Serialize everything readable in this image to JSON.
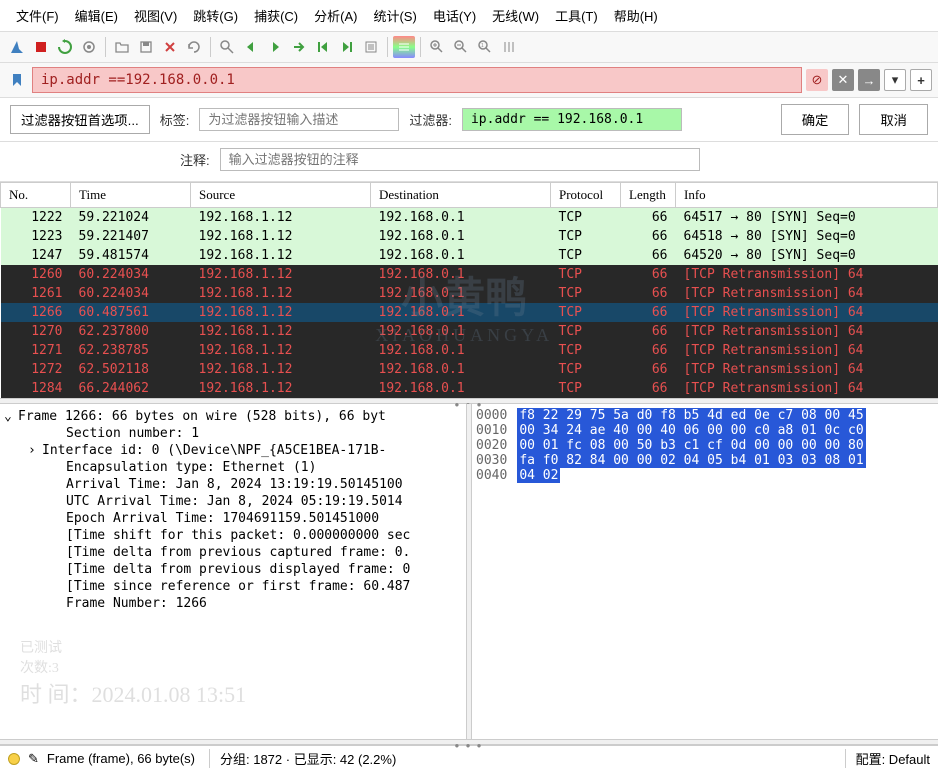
{
  "menu": [
    "文件(F)",
    "编辑(E)",
    "视图(V)",
    "跳转(G)",
    "捕获(C)",
    "分析(A)",
    "统计(S)",
    "电话(Y)",
    "无线(W)",
    "工具(T)",
    "帮助(H)"
  ],
  "filter": {
    "value": "ip.addr ==192.168.0.0.1"
  },
  "pref": {
    "btn": "过滤器按钮首选项...",
    "label_tag": "标签:",
    "tag_placeholder": "为过滤器按钮输入描述",
    "label_filter": "过滤器:",
    "filter_value": "ip.addr == 192.168.0.1",
    "label_comment": "注释:",
    "comment_placeholder": "输入过滤器按钮的注释",
    "ok": "确定",
    "cancel": "取消"
  },
  "cols": {
    "no": "No.",
    "time": "Time",
    "src": "Source",
    "dst": "Destination",
    "proto": "Protocol",
    "len": "Length",
    "info": "Info"
  },
  "packets": [
    {
      "cls": "green",
      "no": "1222",
      "time": "59.221024",
      "src": "192.168.1.12",
      "dst": "192.168.0.1",
      "proto": "TCP",
      "len": "66",
      "info": "64517 → 80 [SYN] Seq=0"
    },
    {
      "cls": "green",
      "no": "1223",
      "time": "59.221407",
      "src": "192.168.1.12",
      "dst": "192.168.0.1",
      "proto": "TCP",
      "len": "66",
      "info": "64518 → 80 [SYN] Seq=0"
    },
    {
      "cls": "green",
      "no": "1247",
      "time": "59.481574",
      "src": "192.168.1.12",
      "dst": "192.168.0.1",
      "proto": "TCP",
      "len": "66",
      "info": "64520 → 80 [SYN] Seq=0"
    },
    {
      "cls": "dark",
      "no": "1260",
      "time": "60.224034",
      "src": "192.168.1.12",
      "dst": "192.168.0.1",
      "proto": "TCP",
      "len": "66",
      "info": "[TCP Retransmission] 64"
    },
    {
      "cls": "dark",
      "no": "1261",
      "time": "60.224034",
      "src": "192.168.1.12",
      "dst": "192.168.0.1",
      "proto": "TCP",
      "len": "66",
      "info": "[TCP Retransmission] 64"
    },
    {
      "cls": "sel",
      "no": "1266",
      "time": "60.487561",
      "src": "192.168.1.12",
      "dst": "192.168.0.1",
      "proto": "TCP",
      "len": "66",
      "info": "[TCP Retransmission] 64"
    },
    {
      "cls": "dark",
      "no": "1270",
      "time": "62.237800",
      "src": "192.168.1.12",
      "dst": "192.168.0.1",
      "proto": "TCP",
      "len": "66",
      "info": "[TCP Retransmission] 64"
    },
    {
      "cls": "dark",
      "no": "1271",
      "time": "62.238785",
      "src": "192.168.1.12",
      "dst": "192.168.0.1",
      "proto": "TCP",
      "len": "66",
      "info": "[TCP Retransmission] 64"
    },
    {
      "cls": "dark",
      "no": "1272",
      "time": "62.502118",
      "src": "192.168.1.12",
      "dst": "192.168.0.1",
      "proto": "TCP",
      "len": "66",
      "info": "[TCP Retransmission] 64"
    },
    {
      "cls": "dark",
      "no": "1284",
      "time": "66.244062",
      "src": "192.168.1.12",
      "dst": "192.168.0.1",
      "proto": "TCP",
      "len": "66",
      "info": "[TCP Retransmission] 64"
    }
  ],
  "tree": [
    {
      "i": 0,
      "c": "v",
      "t": "Frame 1266: 66 bytes on wire (528 bits), 66 byt"
    },
    {
      "i": 2,
      "c": "",
      "t": "Section number: 1"
    },
    {
      "i": 1,
      "c": ">",
      "t": "Interface id: 0 (\\Device\\NPF_{A5CE1BEA-171B-"
    },
    {
      "i": 2,
      "c": "",
      "t": "Encapsulation type: Ethernet (1)"
    },
    {
      "i": 2,
      "c": "",
      "t": "Arrival Time: Jan  8, 2024 13:19:19.50145100"
    },
    {
      "i": 2,
      "c": "",
      "t": "UTC Arrival Time: Jan  8, 2024 05:19:19.5014"
    },
    {
      "i": 2,
      "c": "",
      "t": "Epoch Arrival Time: 1704691159.501451000"
    },
    {
      "i": 2,
      "c": "",
      "t": "[Time shift for this packet: 0.000000000 sec"
    },
    {
      "i": 2,
      "c": "",
      "t": "[Time delta from previous captured frame: 0."
    },
    {
      "i": 2,
      "c": "",
      "t": "[Time delta from previous displayed frame: 0"
    },
    {
      "i": 2,
      "c": "",
      "t": "[Time since reference or first frame: 60.487"
    },
    {
      "i": 2,
      "c": "",
      "t": "Frame Number: 1266"
    }
  ],
  "hex": [
    {
      "off": "0000",
      "b": "f8 22 29 75 5a d0 f8 b5  4d ed 0e c7 08 00 45"
    },
    {
      "off": "0010",
      "b": "00 34 24 ae 40 00 40 06  00 00 c0 a8 01 0c c0"
    },
    {
      "off": "0020",
      "b": "00 01 fc 08 00 50 b3 c1  cf 0d 00 00 00 00 80"
    },
    {
      "off": "0030",
      "b": "fa f0 82 84 00 00 02 04  05 b4 01 03 03 08 01"
    },
    {
      "off": "0040",
      "b": "04 02"
    }
  ],
  "status": {
    "frame": "Frame (frame), 66 byte(s)",
    "mid": "分组: 1872 · 已显示: 42 (2.2%)",
    "profile": "配置: Default"
  },
  "watermark": {
    "big1": "小黄鸭",
    "big2": "XIAOHUANGYA",
    "wm1": "已测试",
    "wm2": "次数:3",
    "wm3": "时  间：2024.01.08 13:51"
  }
}
